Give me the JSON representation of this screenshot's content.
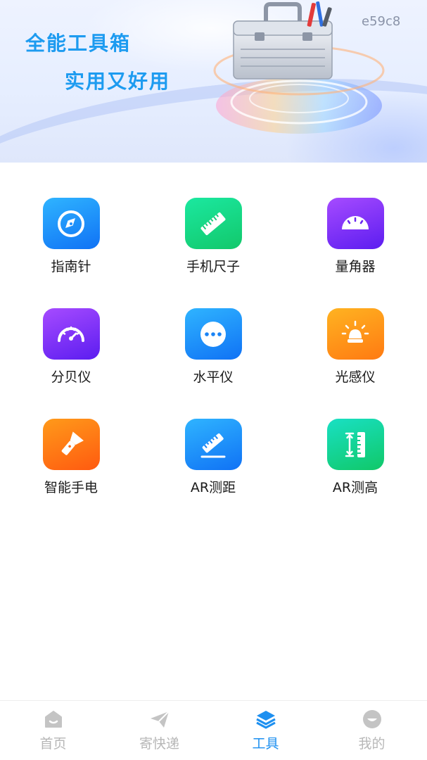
{
  "banner": {
    "title": "全能工具箱",
    "subtitle": "实用又好用",
    "code": "e59c8"
  },
  "tools": [
    {
      "label": "指南针",
      "icon": "compass-icon",
      "color": "#1a8cff"
    },
    {
      "label": "手机尺子",
      "icon": "ruler-icon",
      "color": "#17d98a"
    },
    {
      "label": "量角器",
      "icon": "protractor-icon",
      "color": "#7a2cf5"
    },
    {
      "label": "分贝仪",
      "icon": "decibel-meter-icon",
      "color": "#7a2cf5"
    },
    {
      "label": "水平仪",
      "icon": "level-icon",
      "color": "#1a8cff"
    },
    {
      "label": "光感仪",
      "icon": "light-sensor-icon",
      "color": "#ff9318"
    },
    {
      "label": "智能手电",
      "icon": "flashlight-icon",
      "color": "#ff7214"
    },
    {
      "label": "AR测距",
      "icon": "ar-distance-icon",
      "color": "#1a8cff"
    },
    {
      "label": "AR测高",
      "icon": "ar-height-icon",
      "color": "#17d98a"
    }
  ],
  "nav": {
    "items": [
      {
        "label": "首页",
        "icon": "home-icon",
        "active": false
      },
      {
        "label": "寄快递",
        "icon": "paper-plane-icon",
        "active": false
      },
      {
        "label": "工具",
        "icon": "layers-icon",
        "active": true
      },
      {
        "label": "我的",
        "icon": "profile-icon",
        "active": false
      }
    ],
    "active_color": "#1e90f0",
    "inactive_color": "#b7b7b7"
  }
}
